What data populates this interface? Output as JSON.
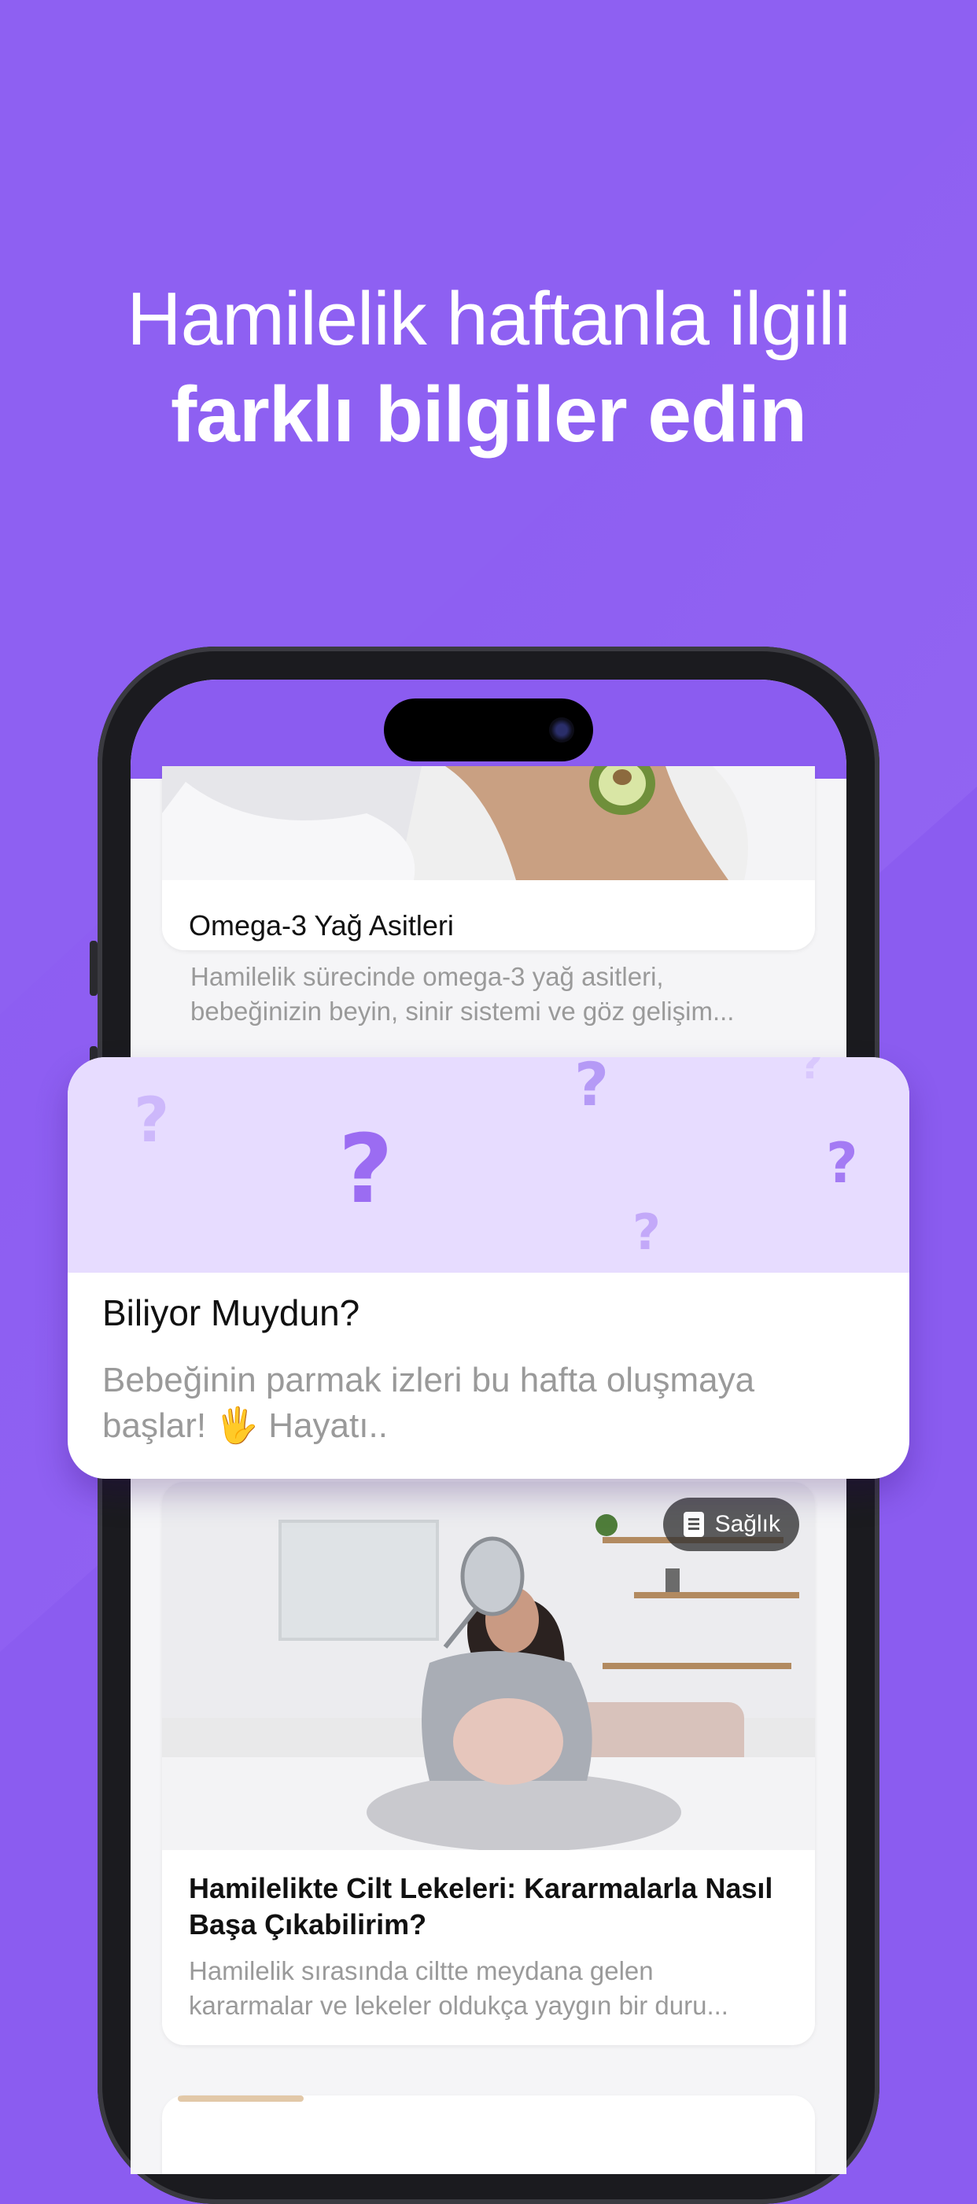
{
  "headline": {
    "line1": "Hamilelik haftanla ilgili",
    "line2": "farklı bilgiler edin"
  },
  "articles": [
    {
      "title": "Omega-3 Yağ Asitleri",
      "description_line1": "Hamilelik sürecinde omega-3 yağ asitleri,",
      "description_line2": "bebeğinizin beyin, sinir sistemi ve göz gelişim..."
    },
    {
      "badge": "Sağlık",
      "badge_icon": "document-icon",
      "title_line1": "Hamilelikte Cilt Lekeleri: Kararmalarla Nasıl",
      "title_line2": "Başa Çıkabilirim?",
      "description_line1": "Hamilelik sırasında ciltte meydana gelen",
      "description_line2": "kararmalar ve lekeler oldukça yaygın bir duru..."
    }
  ],
  "quiz_card": {
    "title": "Biliyor Muydun?",
    "text_line1": "Bebeğinin parmak izleri bu hafta oluşmaya",
    "text_line2": "başlar! 🖐 Hayatı.."
  },
  "colors": {
    "background": "#8b5cf0",
    "quiz_header": "#e7dcff",
    "question_mark": "#9b6cf2"
  }
}
